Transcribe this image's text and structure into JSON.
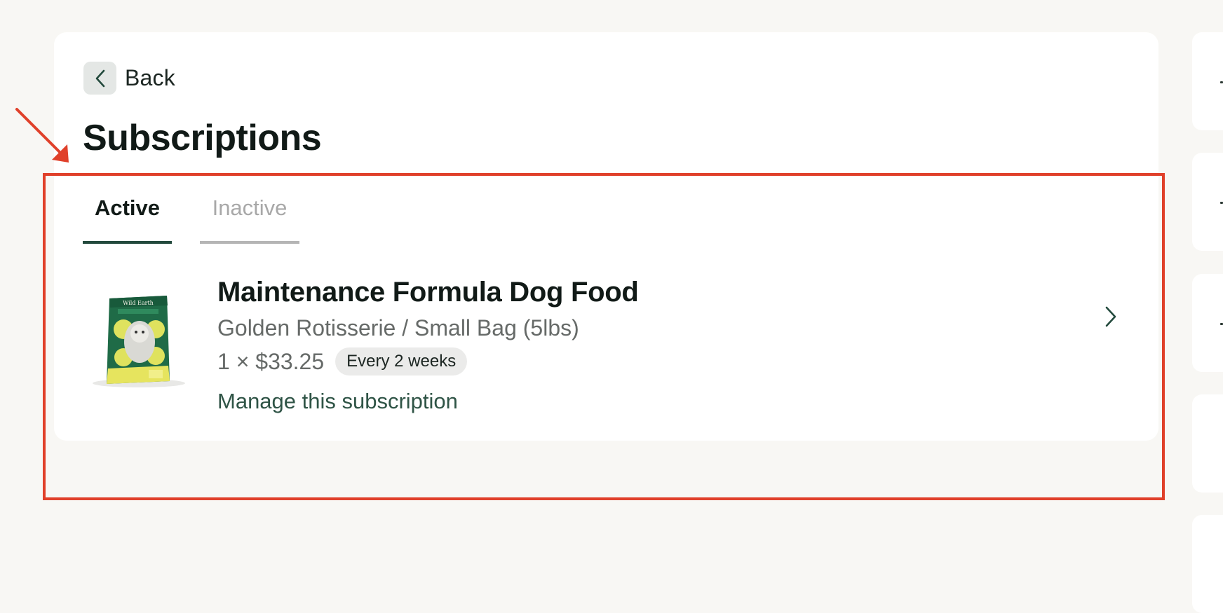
{
  "header": {
    "back_label": "Back",
    "title": "Subscriptions"
  },
  "tabs": [
    {
      "label": "Active",
      "selected": true
    },
    {
      "label": "Inactive",
      "selected": false
    }
  ],
  "subscriptions": [
    {
      "product_name": "Maintenance Formula Dog Food",
      "variant": "Golden Rotisserie / Small Bag (5lbs)",
      "price": "1 × $33.25",
      "frequency": "Every 2 weeks",
      "manage_label": "Manage this subscription",
      "package_brand": "Wild Earth"
    }
  ],
  "icons": {
    "back": "chevron-left-icon",
    "open": "chevron-right-icon"
  },
  "colors": {
    "page_background": "#f8f7f4",
    "card_background": "#ffffff",
    "accent_green": "#234a3d",
    "annotation_red": "#e0402a"
  }
}
